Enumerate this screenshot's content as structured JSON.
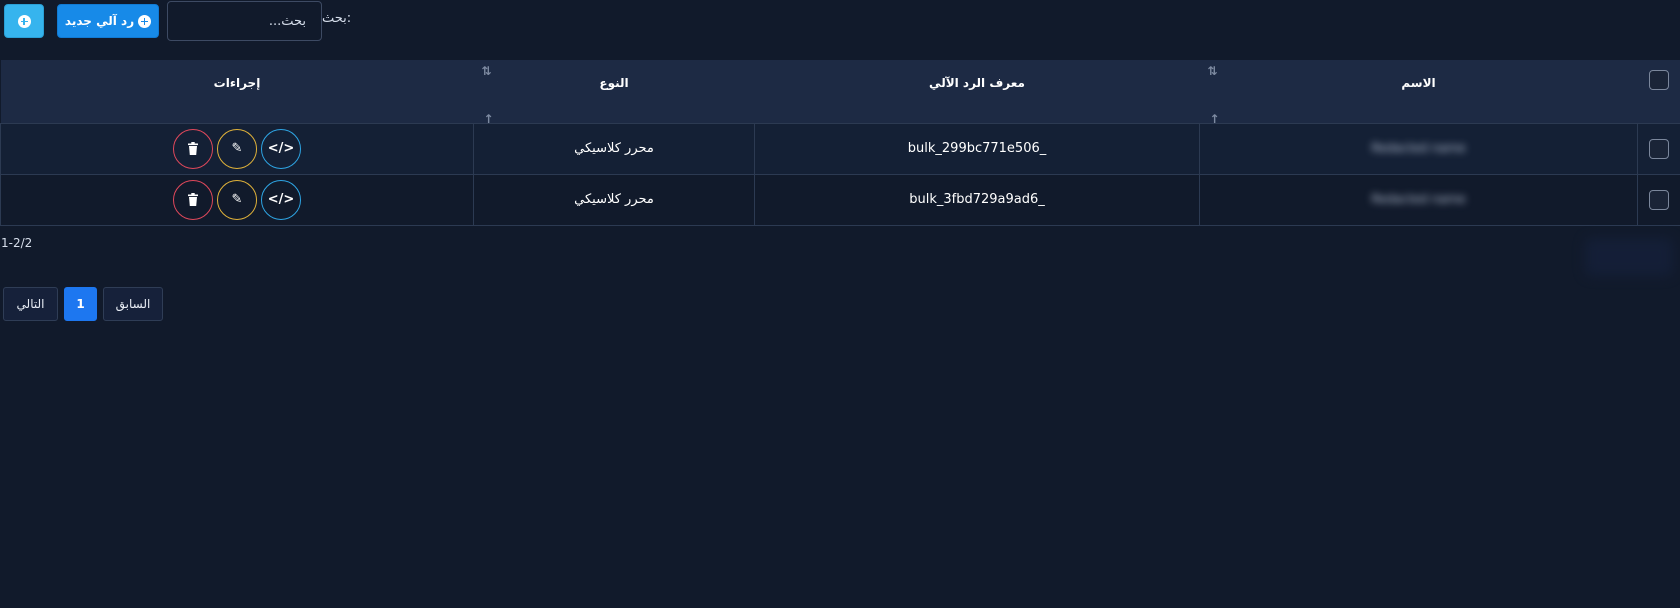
{
  "toolbar": {
    "add_icon": "plus-circle-icon",
    "new_label": "رد آلي جديد",
    "search_label": "بحث:",
    "search_placeholder": "بحث...",
    "search_value": ""
  },
  "table": {
    "headers": {
      "name": "الاسم",
      "id": "معرف الرد الآلي",
      "type": "النوع",
      "actions": "إجراءات"
    },
    "sort_icon": "sort-arrows-icon",
    "rows": [
      {
        "name": "Redacted name",
        "id": "_bulk_299bc771e506",
        "type": "محرر كلاسيكي"
      },
      {
        "name": "Redacted name",
        "id": "_bulk_3fbd729a9ad6",
        "type": "محرر كلاسيكي"
      }
    ],
    "row_action_icons": [
      "code-icon",
      "edit-icon",
      "trash-icon"
    ]
  },
  "footer": {
    "count": "1-2/2",
    "pagination": {
      "next": "التالي",
      "current": "1",
      "prev": "السابق"
    }
  },
  "colors": {
    "background": "#111a2b",
    "header_bg": "#1d2a44",
    "primary": "#178ae8",
    "info": "#36b4ee",
    "code_btn": "#2ea5e4",
    "edit_btn": "#e0b23a",
    "delete_btn": "#e0485b"
  }
}
